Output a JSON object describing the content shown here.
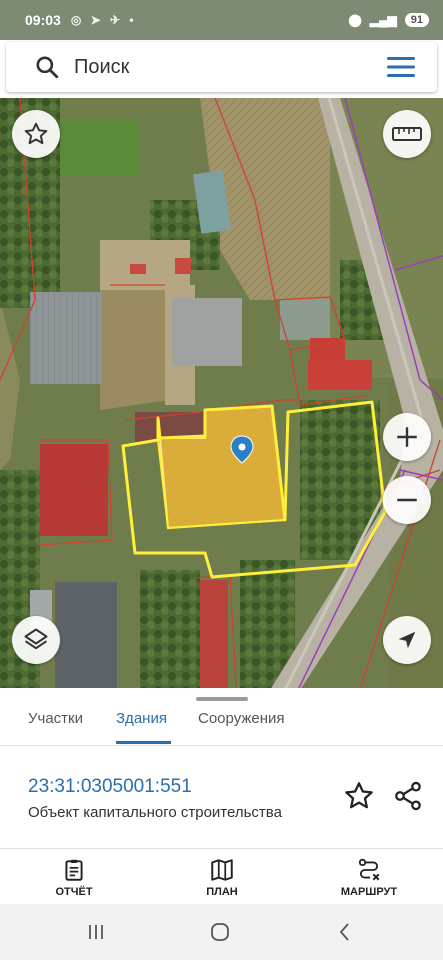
{
  "status_bar": {
    "time": "09:03",
    "battery": "91"
  },
  "search": {
    "placeholder": "Поиск"
  },
  "tabs": [
    {
      "label": "Участки",
      "active": false
    },
    {
      "label": "Здания",
      "active": true
    },
    {
      "label": "Сооружения",
      "active": false
    }
  ],
  "object": {
    "cadastral_number": "23:31:0305001:551",
    "type": "Объект капитального строительства"
  },
  "bottom_nav": [
    {
      "label": "ОТЧЁТ",
      "icon": "report-icon"
    },
    {
      "label": "ПЛАН",
      "icon": "map-plan-icon"
    },
    {
      "label": "МАРШРУТ",
      "icon": "route-icon"
    }
  ],
  "colors": {
    "accent": "#2a6fae",
    "parcel_outline": "#ffef3a",
    "building_fill": "#e6b23a",
    "boundary_red": "#d2412e",
    "boundary_purple": "#9a3fb8"
  }
}
